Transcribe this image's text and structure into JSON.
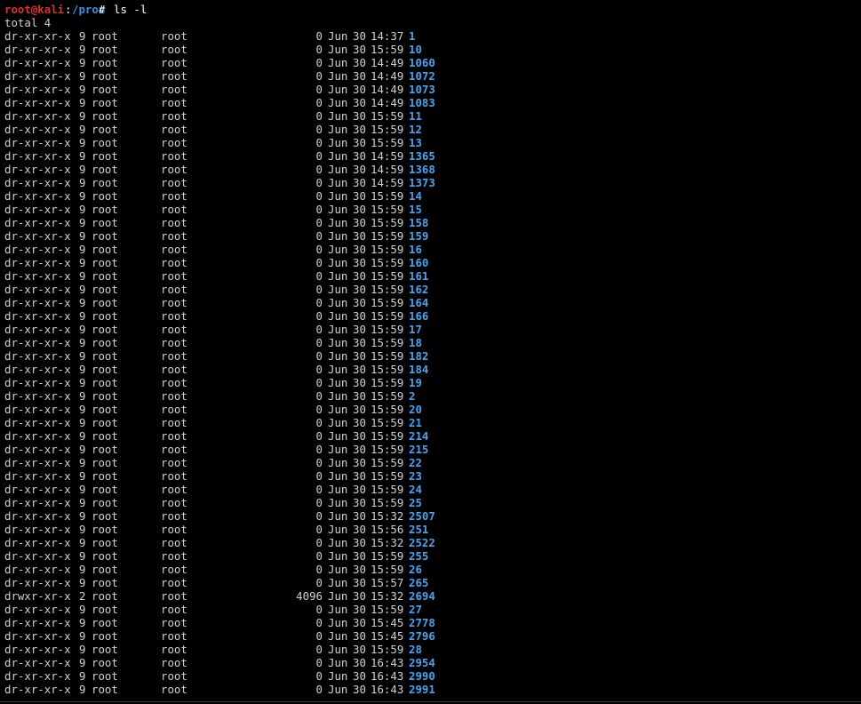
{
  "terminal": {
    "prompt": {
      "user_host": "root@kali",
      "separator": ":",
      "path": "/proc",
      "symbol": "# ",
      "command": "ls -l"
    },
    "total": "total 4",
    "colors": {
      "background": "#000000",
      "text": "#d0d0d0",
      "prompt_user": "#e0302c",
      "prompt_path": "#3b8eea",
      "directory": "#4aa3f0"
    },
    "entries": [
      {
        "perm": "dr-xr-xr-x",
        "links": "9",
        "owner": "root",
        "group": "root",
        "size": "0",
        "month": "Jun",
        "day": "30",
        "time": "14:37",
        "name": "1"
      },
      {
        "perm": "dr-xr-xr-x",
        "links": "9",
        "owner": "root",
        "group": "root",
        "size": "0",
        "month": "Jun",
        "day": "30",
        "time": "15:59",
        "name": "10"
      },
      {
        "perm": "dr-xr-xr-x",
        "links": "9",
        "owner": "root",
        "group": "root",
        "size": "0",
        "month": "Jun",
        "day": "30",
        "time": "14:49",
        "name": "1060"
      },
      {
        "perm": "dr-xr-xr-x",
        "links": "9",
        "owner": "root",
        "group": "root",
        "size": "0",
        "month": "Jun",
        "day": "30",
        "time": "14:49",
        "name": "1072"
      },
      {
        "perm": "dr-xr-xr-x",
        "links": "9",
        "owner": "root",
        "group": "root",
        "size": "0",
        "month": "Jun",
        "day": "30",
        "time": "14:49",
        "name": "1073"
      },
      {
        "perm": "dr-xr-xr-x",
        "links": "9",
        "owner": "root",
        "group": "root",
        "size": "0",
        "month": "Jun",
        "day": "30",
        "time": "14:49",
        "name": "1083"
      },
      {
        "perm": "dr-xr-xr-x",
        "links": "9",
        "owner": "root",
        "group": "root",
        "size": "0",
        "month": "Jun",
        "day": "30",
        "time": "15:59",
        "name": "11"
      },
      {
        "perm": "dr-xr-xr-x",
        "links": "9",
        "owner": "root",
        "group": "root",
        "size": "0",
        "month": "Jun",
        "day": "30",
        "time": "15:59",
        "name": "12"
      },
      {
        "perm": "dr-xr-xr-x",
        "links": "9",
        "owner": "root",
        "group": "root",
        "size": "0",
        "month": "Jun",
        "day": "30",
        "time": "15:59",
        "name": "13"
      },
      {
        "perm": "dr-xr-xr-x",
        "links": "9",
        "owner": "root",
        "group": "root",
        "size": "0",
        "month": "Jun",
        "day": "30",
        "time": "14:59",
        "name": "1365"
      },
      {
        "perm": "dr-xr-xr-x",
        "links": "9",
        "owner": "root",
        "group": "root",
        "size": "0",
        "month": "Jun",
        "day": "30",
        "time": "14:59",
        "name": "1368"
      },
      {
        "perm": "dr-xr-xr-x",
        "links": "9",
        "owner": "root",
        "group": "root",
        "size": "0",
        "month": "Jun",
        "day": "30",
        "time": "14:59",
        "name": "1373"
      },
      {
        "perm": "dr-xr-xr-x",
        "links": "9",
        "owner": "root",
        "group": "root",
        "size": "0",
        "month": "Jun",
        "day": "30",
        "time": "15:59",
        "name": "14"
      },
      {
        "perm": "dr-xr-xr-x",
        "links": "9",
        "owner": "root",
        "group": "root",
        "size": "0",
        "month": "Jun",
        "day": "30",
        "time": "15:59",
        "name": "15"
      },
      {
        "perm": "dr-xr-xr-x",
        "links": "9",
        "owner": "root",
        "group": "root",
        "size": "0",
        "month": "Jun",
        "day": "30",
        "time": "15:59",
        "name": "158"
      },
      {
        "perm": "dr-xr-xr-x",
        "links": "9",
        "owner": "root",
        "group": "root",
        "size": "0",
        "month": "Jun",
        "day": "30",
        "time": "15:59",
        "name": "159"
      },
      {
        "perm": "dr-xr-xr-x",
        "links": "9",
        "owner": "root",
        "group": "root",
        "size": "0",
        "month": "Jun",
        "day": "30",
        "time": "15:59",
        "name": "16"
      },
      {
        "perm": "dr-xr-xr-x",
        "links": "9",
        "owner": "root",
        "group": "root",
        "size": "0",
        "month": "Jun",
        "day": "30",
        "time": "15:59",
        "name": "160"
      },
      {
        "perm": "dr-xr-xr-x",
        "links": "9",
        "owner": "root",
        "group": "root",
        "size": "0",
        "month": "Jun",
        "day": "30",
        "time": "15:59",
        "name": "161"
      },
      {
        "perm": "dr-xr-xr-x",
        "links": "9",
        "owner": "root",
        "group": "root",
        "size": "0",
        "month": "Jun",
        "day": "30",
        "time": "15:59",
        "name": "162"
      },
      {
        "perm": "dr-xr-xr-x",
        "links": "9",
        "owner": "root",
        "group": "root",
        "size": "0",
        "month": "Jun",
        "day": "30",
        "time": "15:59",
        "name": "164"
      },
      {
        "perm": "dr-xr-xr-x",
        "links": "9",
        "owner": "root",
        "group": "root",
        "size": "0",
        "month": "Jun",
        "day": "30",
        "time": "15:59",
        "name": "166"
      },
      {
        "perm": "dr-xr-xr-x",
        "links": "9",
        "owner": "root",
        "group": "root",
        "size": "0",
        "month": "Jun",
        "day": "30",
        "time": "15:59",
        "name": "17"
      },
      {
        "perm": "dr-xr-xr-x",
        "links": "9",
        "owner": "root",
        "group": "root",
        "size": "0",
        "month": "Jun",
        "day": "30",
        "time": "15:59",
        "name": "18"
      },
      {
        "perm": "dr-xr-xr-x",
        "links": "9",
        "owner": "root",
        "group": "root",
        "size": "0",
        "month": "Jun",
        "day": "30",
        "time": "15:59",
        "name": "182"
      },
      {
        "perm": "dr-xr-xr-x",
        "links": "9",
        "owner": "root",
        "group": "root",
        "size": "0",
        "month": "Jun",
        "day": "30",
        "time": "15:59",
        "name": "184"
      },
      {
        "perm": "dr-xr-xr-x",
        "links": "9",
        "owner": "root",
        "group": "root",
        "size": "0",
        "month": "Jun",
        "day": "30",
        "time": "15:59",
        "name": "19"
      },
      {
        "perm": "dr-xr-xr-x",
        "links": "9",
        "owner": "root",
        "group": "root",
        "size": "0",
        "month": "Jun",
        "day": "30",
        "time": "15:59",
        "name": "2"
      },
      {
        "perm": "dr-xr-xr-x",
        "links": "9",
        "owner": "root",
        "group": "root",
        "size": "0",
        "month": "Jun",
        "day": "30",
        "time": "15:59",
        "name": "20"
      },
      {
        "perm": "dr-xr-xr-x",
        "links": "9",
        "owner": "root",
        "group": "root",
        "size": "0",
        "month": "Jun",
        "day": "30",
        "time": "15:59",
        "name": "21"
      },
      {
        "perm": "dr-xr-xr-x",
        "links": "9",
        "owner": "root",
        "group": "root",
        "size": "0",
        "month": "Jun",
        "day": "30",
        "time": "15:59",
        "name": "214"
      },
      {
        "perm": "dr-xr-xr-x",
        "links": "9",
        "owner": "root",
        "group": "root",
        "size": "0",
        "month": "Jun",
        "day": "30",
        "time": "15:59",
        "name": "215"
      },
      {
        "perm": "dr-xr-xr-x",
        "links": "9",
        "owner": "root",
        "group": "root",
        "size": "0",
        "month": "Jun",
        "day": "30",
        "time": "15:59",
        "name": "22"
      },
      {
        "perm": "dr-xr-xr-x",
        "links": "9",
        "owner": "root",
        "group": "root",
        "size": "0",
        "month": "Jun",
        "day": "30",
        "time": "15:59",
        "name": "23"
      },
      {
        "perm": "dr-xr-xr-x",
        "links": "9",
        "owner": "root",
        "group": "root",
        "size": "0",
        "month": "Jun",
        "day": "30",
        "time": "15:59",
        "name": "24"
      },
      {
        "perm": "dr-xr-xr-x",
        "links": "9",
        "owner": "root",
        "group": "root",
        "size": "0",
        "month": "Jun",
        "day": "30",
        "time": "15:59",
        "name": "25"
      },
      {
        "perm": "dr-xr-xr-x",
        "links": "9",
        "owner": "root",
        "group": "root",
        "size": "0",
        "month": "Jun",
        "day": "30",
        "time": "15:32",
        "name": "2507"
      },
      {
        "perm": "dr-xr-xr-x",
        "links": "9",
        "owner": "root",
        "group": "root",
        "size": "0",
        "month": "Jun",
        "day": "30",
        "time": "15:56",
        "name": "251"
      },
      {
        "perm": "dr-xr-xr-x",
        "links": "9",
        "owner": "root",
        "group": "root",
        "size": "0",
        "month": "Jun",
        "day": "30",
        "time": "15:32",
        "name": "2522"
      },
      {
        "perm": "dr-xr-xr-x",
        "links": "9",
        "owner": "root",
        "group": "root",
        "size": "0",
        "month": "Jun",
        "day": "30",
        "time": "15:59",
        "name": "255"
      },
      {
        "perm": "dr-xr-xr-x",
        "links": "9",
        "owner": "root",
        "group": "root",
        "size": "0",
        "month": "Jun",
        "day": "30",
        "time": "15:59",
        "name": "26"
      },
      {
        "perm": "dr-xr-xr-x",
        "links": "9",
        "owner": "root",
        "group": "root",
        "size": "0",
        "month": "Jun",
        "day": "30",
        "time": "15:57",
        "name": "265"
      },
      {
        "perm": "drwxr-xr-x",
        "links": "2",
        "owner": "root",
        "group": "root",
        "size": "4096",
        "month": "Jun",
        "day": "30",
        "time": "15:32",
        "name": "2694"
      },
      {
        "perm": "dr-xr-xr-x",
        "links": "9",
        "owner": "root",
        "group": "root",
        "size": "0",
        "month": "Jun",
        "day": "30",
        "time": "15:59",
        "name": "27"
      },
      {
        "perm": "dr-xr-xr-x",
        "links": "9",
        "owner": "root",
        "group": "root",
        "size": "0",
        "month": "Jun",
        "day": "30",
        "time": "15:45",
        "name": "2778"
      },
      {
        "perm": "dr-xr-xr-x",
        "links": "9",
        "owner": "root",
        "group": "root",
        "size": "0",
        "month": "Jun",
        "day": "30",
        "time": "15:45",
        "name": "2796"
      },
      {
        "perm": "dr-xr-xr-x",
        "links": "9",
        "owner": "root",
        "group": "root",
        "size": "0",
        "month": "Jun",
        "day": "30",
        "time": "15:59",
        "name": "28"
      },
      {
        "perm": "dr-xr-xr-x",
        "links": "9",
        "owner": "root",
        "group": "root",
        "size": "0",
        "month": "Jun",
        "day": "30",
        "time": "16:43",
        "name": "2954"
      },
      {
        "perm": "dr-xr-xr-x",
        "links": "9",
        "owner": "root",
        "group": "root",
        "size": "0",
        "month": "Jun",
        "day": "30",
        "time": "16:43",
        "name": "2990"
      },
      {
        "perm": "dr-xr-xr-x",
        "links": "9",
        "owner": "root",
        "group": "root",
        "size": "0",
        "month": "Jun",
        "day": "30",
        "time": "16:43",
        "name": "2991"
      }
    ]
  }
}
